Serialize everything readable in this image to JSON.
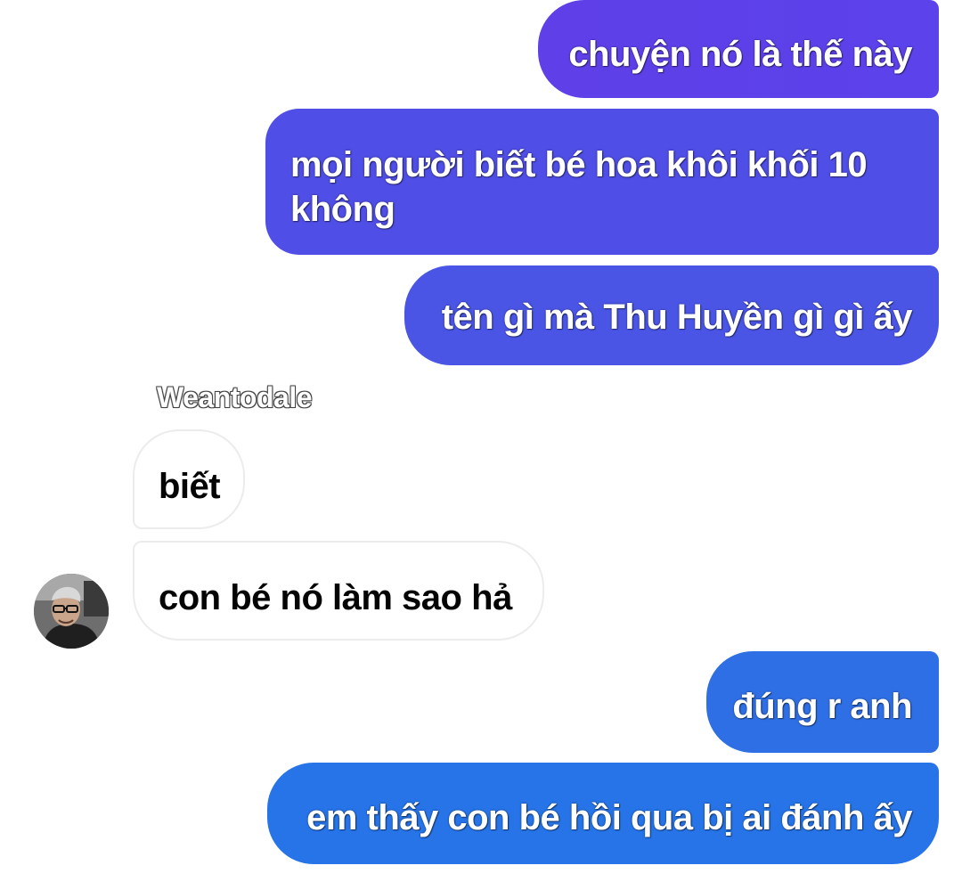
{
  "conversation": {
    "messages": [
      {
        "direction": "outgoing",
        "text": "chuyện nó là thế này"
      },
      {
        "direction": "outgoing",
        "text": "mọi người biết bé hoa khôi khối 10 không"
      },
      {
        "direction": "outgoing",
        "text": "tên gì mà Thu Huyền gì gì ấy"
      },
      {
        "direction": "incoming",
        "text": "biết"
      },
      {
        "direction": "incoming",
        "text": "con bé nó làm sao hả"
      },
      {
        "direction": "outgoing",
        "text": "đúng r anh"
      },
      {
        "direction": "outgoing",
        "text": "em thấy con bé hồi qua bị ai đánh ấy"
      }
    ],
    "incoming_sender": "Weantodale"
  },
  "icons": {
    "avatar": "user-avatar-photo"
  },
  "colors": {
    "outgoing_top": "#5f3fe8",
    "outgoing_bottom": "#2674e8",
    "incoming_bg": "#ffffff",
    "incoming_border": "#ececec",
    "page_bg": "#ffffff"
  }
}
